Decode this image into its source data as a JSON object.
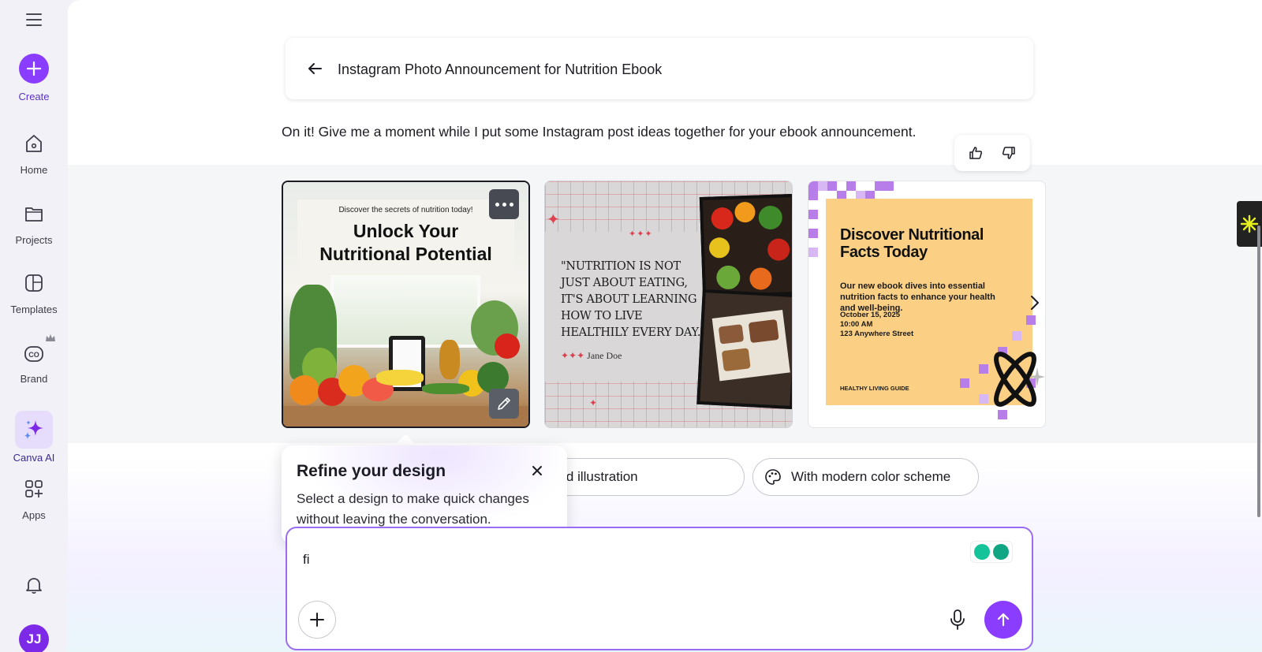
{
  "sidebar": {
    "create_label": "Create",
    "items": [
      {
        "label": "Home",
        "icon": "home-icon"
      },
      {
        "label": "Projects",
        "icon": "folder-icon"
      },
      {
        "label": "Templates",
        "icon": "templates-icon"
      },
      {
        "label": "Brand",
        "icon": "brand-icon"
      },
      {
        "label": "Canva AI",
        "icon": "sparkle-icon"
      },
      {
        "label": "Apps",
        "icon": "apps-icon"
      }
    ],
    "avatar_initials": "JJ",
    "accent": "#8b3dff"
  },
  "conversation": {
    "title": "Instagram Photo Announcement for Nutrition Ebook",
    "reply": "On it! Give me a moment while I put some Instagram post ideas together for your ebook announcement."
  },
  "designs": {
    "card1": {
      "small": "Discover the secrets of nutrition today!",
      "headline_line1": "Unlock Your",
      "headline_line2": "Nutritional Potential"
    },
    "card2": {
      "quote": "\"NUTRITION IS NOT JUST ABOUT EATING, IT'S ABOUT LEARNING HOW TO LIVE HEALTHILY EVERY DAY.\"",
      "stars": "✦✦✦",
      "author": "Jane Doe"
    },
    "card3": {
      "title": "Discover Nutritional Facts Today",
      "body": "Our new ebook dives into essential nutrition facts to enhance your health and well-being.",
      "date": "October 15, 2025",
      "time": "10:00 AM",
      "address": "123 Anywhere Street",
      "guide": "HEALTHY LIVING GUIDE"
    }
  },
  "suggestions": {
    "chip1": "ood illustration",
    "chip2": "With modern color scheme"
  },
  "popover": {
    "title": "Refine your design",
    "body": "Select a design to make quick changes without leaving the conversation."
  },
  "composer": {
    "value": "fi"
  }
}
